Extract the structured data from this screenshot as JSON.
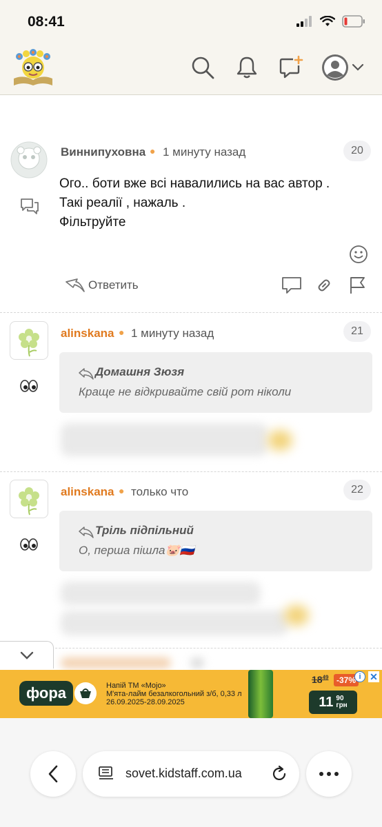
{
  "status_bar": {
    "time": "08:41"
  },
  "header": {
    "icons": [
      "search-icon",
      "bell-icon",
      "new-message-icon",
      "profile-avatar-icon",
      "chevron-down-icon"
    ]
  },
  "comments": [
    {
      "author": "Виннипуховна",
      "author_color": "#555555",
      "timestamp": "1 минуту назад",
      "number": "20",
      "lines": [
        "Ого.. боти вже всі навалились на вас автор .",
        "Такі реалії , нажаль .",
        "Фільтруйте"
      ],
      "actions": {
        "reply": "Ответить"
      }
    },
    {
      "author": "alinskana",
      "author_color": "#e07a1f",
      "timestamp": "1 минуту назад",
      "number": "21",
      "quote": {
        "author": "Домашня Зюзя",
        "text": "Краще не відкривайте свій рот ніколи"
      }
    },
    {
      "author": "alinskana",
      "author_color": "#e07a1f",
      "timestamp": "только что",
      "number": "22",
      "quote": {
        "author": "Тріль підпільний",
        "text": "О, перша пішла🐷🇷🇺"
      }
    }
  ],
  "ad": {
    "brand": "фора",
    "text_line1": "Напій ТМ «Mojo»",
    "text_line2": "М'ята-лайм безалкогольний з/б, 0,33 л",
    "text_line3": "26.09.2025-28.09.2025",
    "old_price": "18",
    "old_price_kop": "49",
    "discount": "-37%",
    "price": "11",
    "price_kop": "90",
    "currency": "грн"
  },
  "browser": {
    "url": "sovet.kidstaff.com.ua"
  }
}
